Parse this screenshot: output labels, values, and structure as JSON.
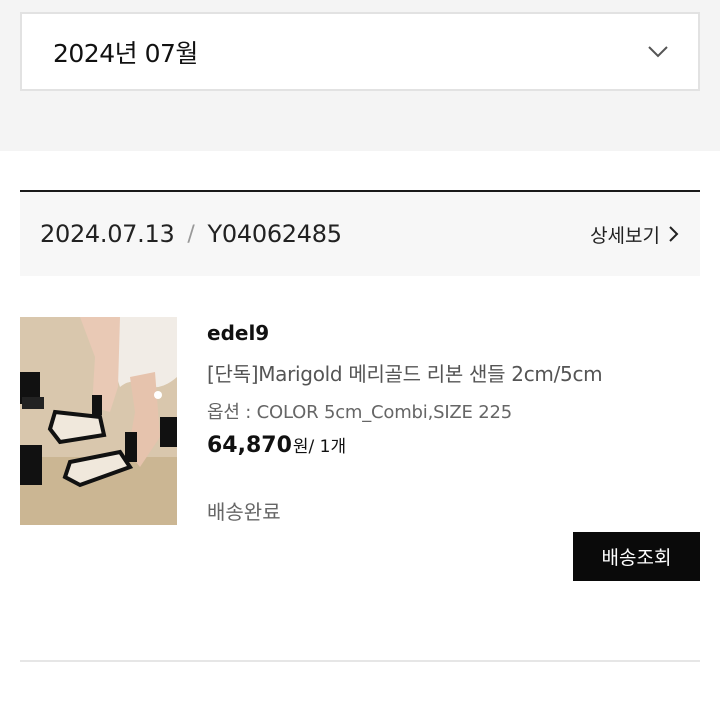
{
  "filter": {
    "selected_month": "2024년 07월",
    "icon": "chevron-down-icon"
  },
  "order": {
    "date": "2024.07.13",
    "separator": "/",
    "order_number": "Y04062485",
    "detail_label": "상세보기",
    "detail_icon": "chevron-right-icon",
    "item": {
      "thumbnail": "product-photo",
      "brand": "edel9",
      "name": "[단독]Marigold 메리골드 리본 샌들 2cm/5cm",
      "option": "옵션 : COLOR 5cm_Combi,SIZE 225",
      "price": "64,870",
      "price_unit": "원",
      "quantity": "/ 1개",
      "status": "배송완료",
      "track_label": "배송조회"
    }
  },
  "colors": {
    "button_bg": "#0a0a0a",
    "button_text": "#ffffff",
    "band_bg": "#f4f4f4",
    "header_bg": "#f7f7f7"
  }
}
